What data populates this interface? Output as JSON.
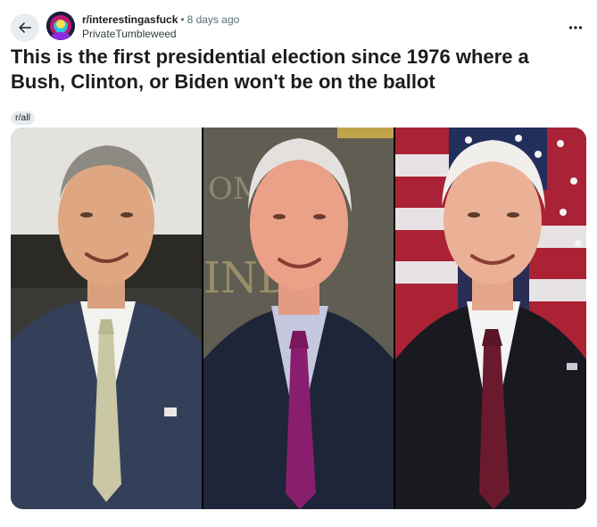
{
  "post": {
    "subreddit": "r/interestingasfuck",
    "separator": "•",
    "time_ago": "8 days ago",
    "author": "PrivateTumbleweed",
    "title": "This is the first presidential election since 1976 where a Bush, Clinton, or Biden won't be on the ballot",
    "flair": "r/all"
  },
  "icons": {
    "back": "arrow-left-icon",
    "more": "ellipsis-horizontal-icon"
  },
  "colors": {
    "back_button_bg": "#eaedef",
    "flair_bg": "#e5ebee",
    "meta_gray": "#576f76"
  }
}
